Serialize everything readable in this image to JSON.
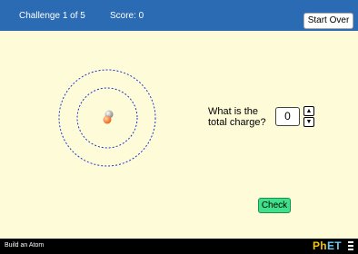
{
  "header": {
    "challenge": "Challenge 1 of 5",
    "score": "Score: 0",
    "start_over_label": "Start Over"
  },
  "question": {
    "line1": "What is the",
    "line2": "total charge?",
    "answer_value": "0",
    "up_arrow": "▲",
    "down_arrow": "▼"
  },
  "check_label": "Check",
  "footer": {
    "app_title": "Build an Atom",
    "logo_ph": "Ph",
    "logo_et": "ET"
  },
  "atom": {
    "protons": 1,
    "neutrons": 1,
    "electrons": 0
  },
  "colors": {
    "header": "#2b6bb3",
    "background": "#fefcd8",
    "check_button": "#3ee08a",
    "proton": "#f07a30",
    "neutron": "#aaaaaa",
    "orbit": "#2233cc"
  }
}
